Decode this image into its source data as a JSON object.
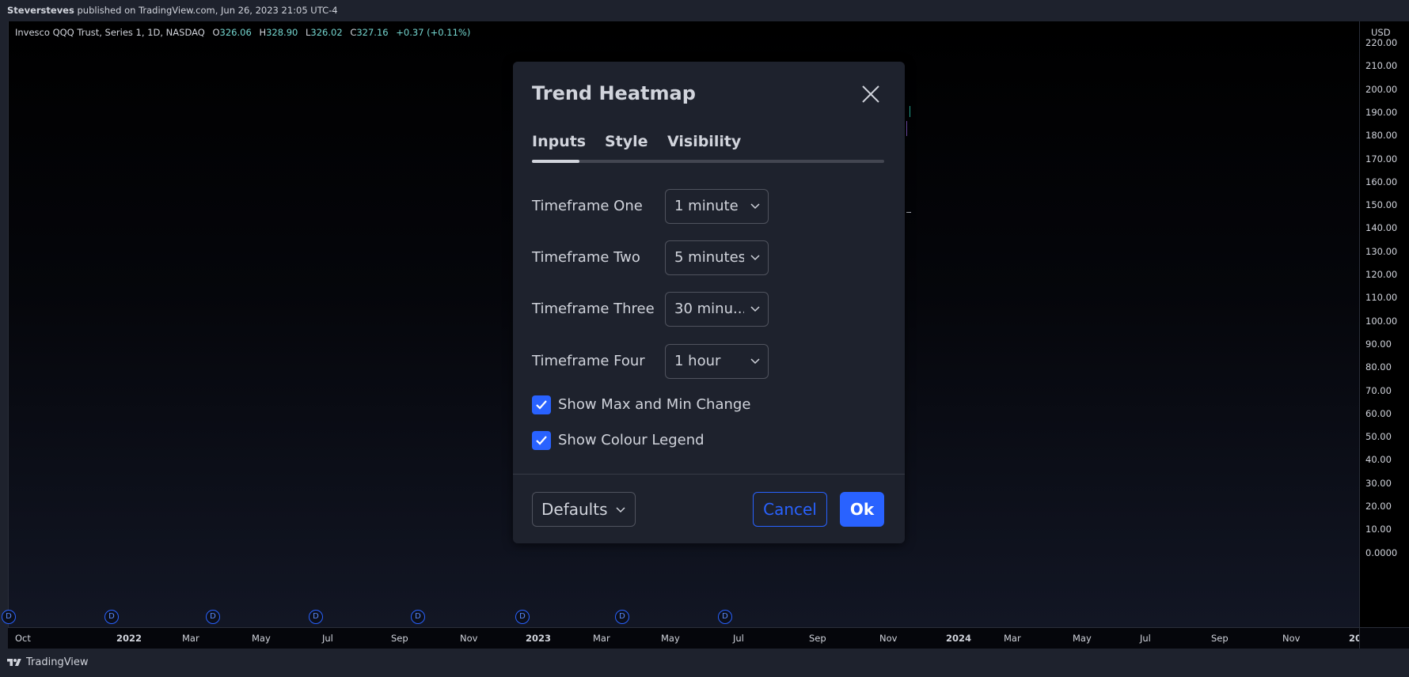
{
  "publish_bar": {
    "author": "Steversteves",
    "text": " published on TradingView.com, Jun 26, 2023 21:05 UTC-4"
  },
  "legend": {
    "symbol": "Invesco QQQ Trust, Series 1, 1D, NASDAQ",
    "o_label": "O",
    "o_value": "326.06",
    "h_label": "H",
    "h_value": "328.90",
    "l_label": "L",
    "l_value": "326.02",
    "c_label": "C",
    "c_value": "327.16",
    "change": "+0.37 (+0.11%)"
  },
  "price_axis": {
    "currency": "USD",
    "ticks": [
      "220.00",
      "210.00",
      "200.00",
      "190.00",
      "180.00",
      "170.00",
      "160.00",
      "150.00",
      "140.00",
      "130.00",
      "120.00",
      "110.00",
      "100.00",
      "90.00",
      "80.00",
      "70.00",
      "60.00",
      "50.00",
      "40.00",
      "30.00",
      "20.00",
      "10.00",
      "0.0000"
    ]
  },
  "time_axis": {
    "ticks": [
      {
        "label": "Oct",
        "bold": false
      },
      {
        "label": "2022",
        "bold": true
      },
      {
        "label": "Mar",
        "bold": false
      },
      {
        "label": "May",
        "bold": false
      },
      {
        "label": "Jul",
        "bold": false
      },
      {
        "label": "Sep",
        "bold": false
      },
      {
        "label": "Nov",
        "bold": false
      },
      {
        "label": "2023",
        "bold": true
      },
      {
        "label": "Mar",
        "bold": false
      },
      {
        "label": "May",
        "bold": false
      },
      {
        "label": "Jul",
        "bold": false
      },
      {
        "label": "Sep",
        "bold": false
      },
      {
        "label": "Nov",
        "bold": false
      },
      {
        "label": "2024",
        "bold": true
      },
      {
        "label": "Mar",
        "bold": false
      },
      {
        "label": "May",
        "bold": false
      },
      {
        "label": "Jul",
        "bold": false
      },
      {
        "label": "Sep",
        "bold": false
      },
      {
        "label": "Nov",
        "bold": false
      },
      {
        "label": "20",
        "bold": true
      }
    ]
  },
  "dividend_marker": "D",
  "footer": {
    "brand": "TradingView"
  },
  "dialog": {
    "title": "Trend Heatmap",
    "tabs": [
      "Inputs",
      "Style",
      "Visibility"
    ],
    "active_tab": "Inputs",
    "inputs": [
      {
        "label": "Timeframe One",
        "value": "1 minute"
      },
      {
        "label": "Timeframe Two",
        "value": "5 minutes"
      },
      {
        "label": "Timeframe Three",
        "value": "30 minu..."
      },
      {
        "label": "Timeframe Four",
        "value": "1 hour"
      }
    ],
    "checkboxes": [
      {
        "label": "Show Max and Min Change",
        "checked": true
      },
      {
        "label": "Show Colour Legend",
        "checked": true
      }
    ],
    "defaults_label": "Defaults",
    "cancel_label": "Cancel",
    "ok_label": "Ok"
  },
  "colors": {
    "accent": "#2962ff",
    "legend_value": "#74d6d0",
    "background": "#1e222d"
  }
}
